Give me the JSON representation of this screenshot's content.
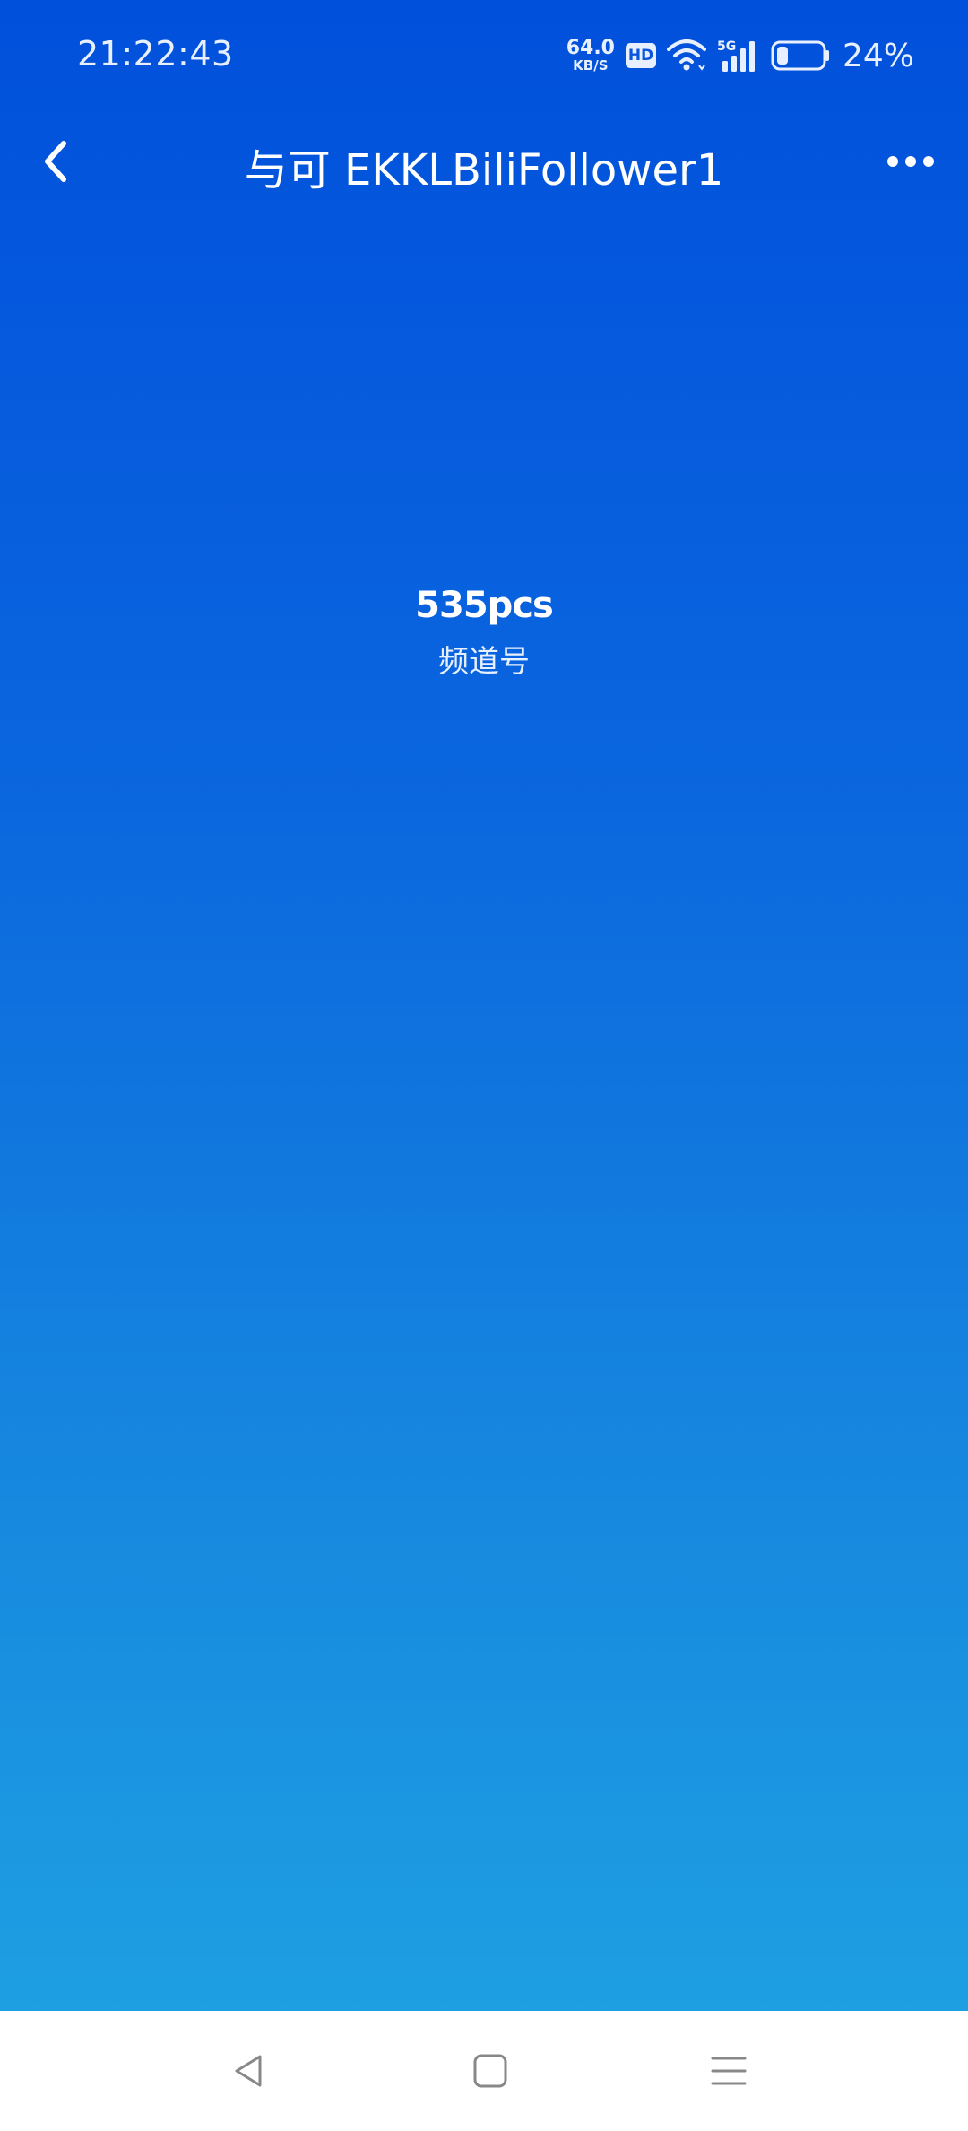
{
  "status_bar": {
    "time": "21:22:43",
    "net_speed_value": "64.0",
    "net_speed_unit": "KB/S",
    "hd_label": "HD",
    "network_type": "5G",
    "battery_percent": "24%",
    "battery_level": 0.24
  },
  "header": {
    "title": "与可 EKKLBiliFollower1"
  },
  "main": {
    "value": "535pcs",
    "label": "频道号"
  },
  "icons": {
    "back": "chevron-left-icon",
    "more": "more-horizontal-icon",
    "wifi": "wifi-icon",
    "signal": "signal-icon",
    "battery": "battery-icon",
    "nav_back": "triangle-back-icon",
    "nav_home": "square-home-icon",
    "nav_menu": "menu-lines-icon"
  },
  "colors": {
    "gradient_top": "#0150dc",
    "gradient_bottom": "#1e9fe2",
    "text": "#ffffff",
    "nav_bg": "#ffffff",
    "nav_icon": "#888888"
  }
}
